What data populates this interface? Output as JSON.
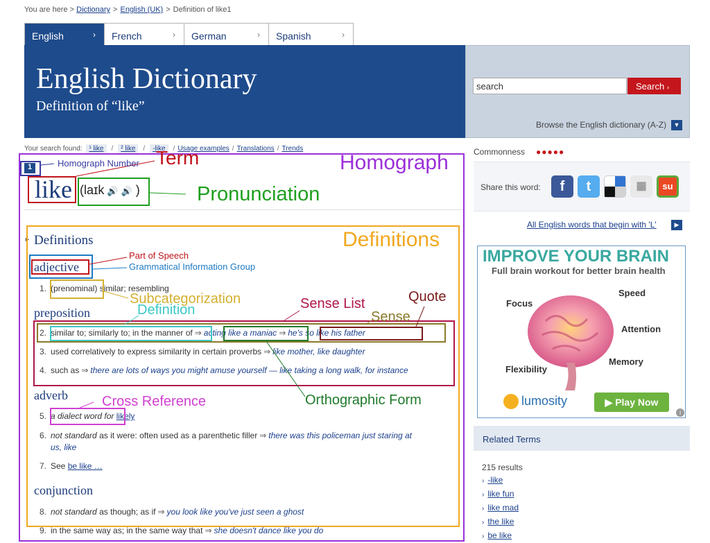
{
  "breadcrumb": {
    "prefix": "You are here >",
    "items": [
      "Dictionary",
      "English (UK)"
    ],
    "current": "Definition of like1"
  },
  "tabs": [
    {
      "label": "English",
      "active": true
    },
    {
      "label": "French"
    },
    {
      "label": "German"
    },
    {
      "label": "Spanish"
    }
  ],
  "header": {
    "title": "English Dictionary",
    "subtitle": "Definition of “like”",
    "search_value": "search",
    "search_button": "Search",
    "browse": "Browse the English dictionary (A-Z)"
  },
  "search_found": {
    "label": "Your search found:",
    "items": [
      "¹ like",
      "² like",
      "-like",
      "Usage examples",
      "Translations",
      "Trends"
    ]
  },
  "entry": {
    "homograph_number": "1",
    "term": "like",
    "pronunciation": "laɪk",
    "definitions_heading": "Definitions",
    "pos_adjective": "adjective",
    "s1_num": "1.",
    "s1_subcat": "(prenominal)",
    "s1_def": "similar; resembling",
    "pos_preposition": "preposition",
    "s2_num": "2.",
    "s2_def": "similar to; similarly to; in the manner of",
    "s2_ex1": "acting like a maniac",
    "s2_ex2": "he's so like his father",
    "s3_num": "3.",
    "s3_def": "used correlatively to express similarity in certain proverbs",
    "s3_ex": "like mother, like daughter",
    "s4_num": "4.",
    "s4_def": "such as",
    "s4_ex": "there are lots of ways you might amuse yourself — like taking a long walk, for instance",
    "pos_adverb": "adverb",
    "s5_num": "5.",
    "s5_xref": "a dialect word for",
    "s5_link": "likely",
    "s6_num": "6.",
    "s6_label": "not standard",
    "s6_def": "as it were: often used as a parenthetic filler",
    "s6_ex_a": "there was this policeman just staring at",
    "s6_ex_b": "us, like",
    "s7_num": "7.",
    "s7_see": "See",
    "s7_link": "be like …",
    "pos_conjunction": "conjunction",
    "s8_num": "8.",
    "s8_label": "not standard",
    "s8_def": "as though; as if",
    "s8_ex": "you look like you've just seen a ghost",
    "s9_num": "9.",
    "s9_def": "in the same way as; in the same way that",
    "s9_ex": "she doesn't dance like you do"
  },
  "sidebar": {
    "commonness": "Commonness",
    "commonness_level": 5,
    "share_label": "Share this word:",
    "all_words": "All English words that begin with 'L'",
    "ad": {
      "headline": "IMPROVE YOUR BRAIN",
      "subline": "Full brain workout for better brain health",
      "focus": "Focus",
      "speed": "Speed",
      "attention": "Attention",
      "flexibility": "Flexibility",
      "memory": "Memory",
      "brand": "lumosity",
      "cta": "▶ Play Now"
    },
    "related_title": "Related Terms",
    "results": "215 results",
    "related": [
      "-like",
      "like fun",
      "like mad",
      "the like",
      "be like"
    ]
  },
  "annotations": {
    "homograph_number": "Homograph Number",
    "term": "Term",
    "homograph": "Homograph",
    "pronunciation": "Pronunciation",
    "definitions": "Definitions",
    "part_of_speech": "Part of Speech",
    "grammatical_group": "Grammatical Information Group",
    "subcategorization": "Subcategorization",
    "definition": "Definition",
    "sense_list": "Sense List",
    "sense": "Sense",
    "quote": "Quote",
    "orthographic_form": "Orthographic Form",
    "cross_reference": "Cross Reference"
  },
  "colors": {
    "brand_blue": "#1e4b8c",
    "search_red": "#c4161c",
    "homograph": "#9b30d9",
    "term": "#c0141b",
    "pron": "#1f9f1f",
    "definitions": "#f0a820",
    "pos": "#c0141b",
    "group": "#1e7bc4",
    "subcat": "#d4b030",
    "def": "#3cc8c8",
    "sense_list": "#b0154a",
    "sense": "#8a7a2a",
    "quote": "#7a1a1a",
    "ortho": "#1f7a2a",
    "xref": "#d040d0",
    "homo_num": "#3a3aa0"
  }
}
